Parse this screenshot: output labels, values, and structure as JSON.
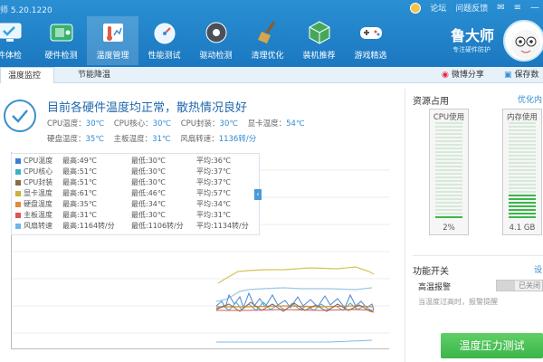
{
  "window": {
    "title_fragment": "师 5.20.1220",
    "controls": [
      "论坛",
      "问题反馈"
    ]
  },
  "nav": {
    "items": [
      {
        "label": "件体检",
        "icon": "monitor-check-icon",
        "color": "#2fa3e4"
      },
      {
        "label": "硬件检测",
        "icon": "hardware-icon",
        "color": "#36b36f"
      },
      {
        "label": "温度管理",
        "icon": "thermometer-icon",
        "color": "#e05a46",
        "active": true
      },
      {
        "label": "性能测试",
        "icon": "speedometer-icon",
        "color": "#3d8ed6"
      },
      {
        "label": "驱动检测",
        "icon": "gear-icon",
        "color": "#4b4f5a"
      },
      {
        "label": "清理优化",
        "icon": "broom-icon",
        "color": "#c07a2c"
      },
      {
        "label": "装机推荐",
        "icon": "cube-icon",
        "color": "#44a85a"
      },
      {
        "label": "游戏精选",
        "icon": "gamepad-icon",
        "color": "#ffffff"
      }
    ]
  },
  "brand": {
    "name": "鲁大师",
    "tagline": "专注硬件防护"
  },
  "tabs": [
    {
      "label": "温度监控",
      "active": true
    },
    {
      "label": "节能降温",
      "active": false
    }
  ],
  "share": {
    "weibo": "微博分享",
    "save": "保存数"
  },
  "status": {
    "headline": "目前各硬件温度均正常，散热情况良好",
    "row1": [
      {
        "label": "CPU温度：",
        "value": "30℃"
      },
      {
        "label": "CPU核心：",
        "value": "30℃"
      },
      {
        "label": "CPU封装：",
        "value": "30℃"
      },
      {
        "label": "显卡温度：",
        "value": "54℃"
      }
    ],
    "row2": [
      {
        "label": "硬盘温度：",
        "value": "35℃"
      },
      {
        "label": "主板温度：",
        "value": "31℃"
      },
      {
        "label": "风扇转速：",
        "value": "1136转/分"
      }
    ]
  },
  "legend": [
    {
      "name": "CPU温度",
      "max": "最高:49℃",
      "min": "最低:30℃",
      "avg": "平均:36℃",
      "color": "#3a7fd5"
    },
    {
      "name": "CPU核心",
      "max": "最高:51℃",
      "min": "最低:30℃",
      "avg": "平均:37℃",
      "color": "#3bb0c9"
    },
    {
      "name": "CPU封装",
      "max": "最高:51℃",
      "min": "最低:30℃",
      "avg": "平均:37℃",
      "color": "#8b6a4a"
    },
    {
      "name": "显卡温度",
      "max": "最高:61℃",
      "min": "最低:46℃",
      "avg": "平均:57℃",
      "color": "#c7b33a"
    },
    {
      "name": "硬盘温度",
      "max": "最高:35℃",
      "min": "最低:34℃",
      "avg": "平均:34℃",
      "color": "#e38a3a"
    },
    {
      "name": "主板温度",
      "max": "最高:31℃",
      "min": "最低:30℃",
      "avg": "平均:31℃",
      "color": "#d65757"
    },
    {
      "name": "风扇转速",
      "max": "最高:1164转/分",
      "min": "最低:1106转/分",
      "avg": "平均:1134转/分",
      "color": "#6bb7e8"
    }
  ],
  "resources": {
    "title": "资源占用",
    "link": "优化内",
    "cpu": {
      "title": "CPU使用",
      "value": "2%",
      "fraction": 0.02
    },
    "mem": {
      "title": "内存使用",
      "value": "4.1 GB",
      "fraction": 0.27
    }
  },
  "functions": {
    "title": "功能开关",
    "link": "设",
    "high_temp_alarm": {
      "label": "高温报警",
      "state": "已关闭",
      "desc": "当温度过高时，报警提醒"
    }
  },
  "stress_test_button": "温度压力测试"
}
